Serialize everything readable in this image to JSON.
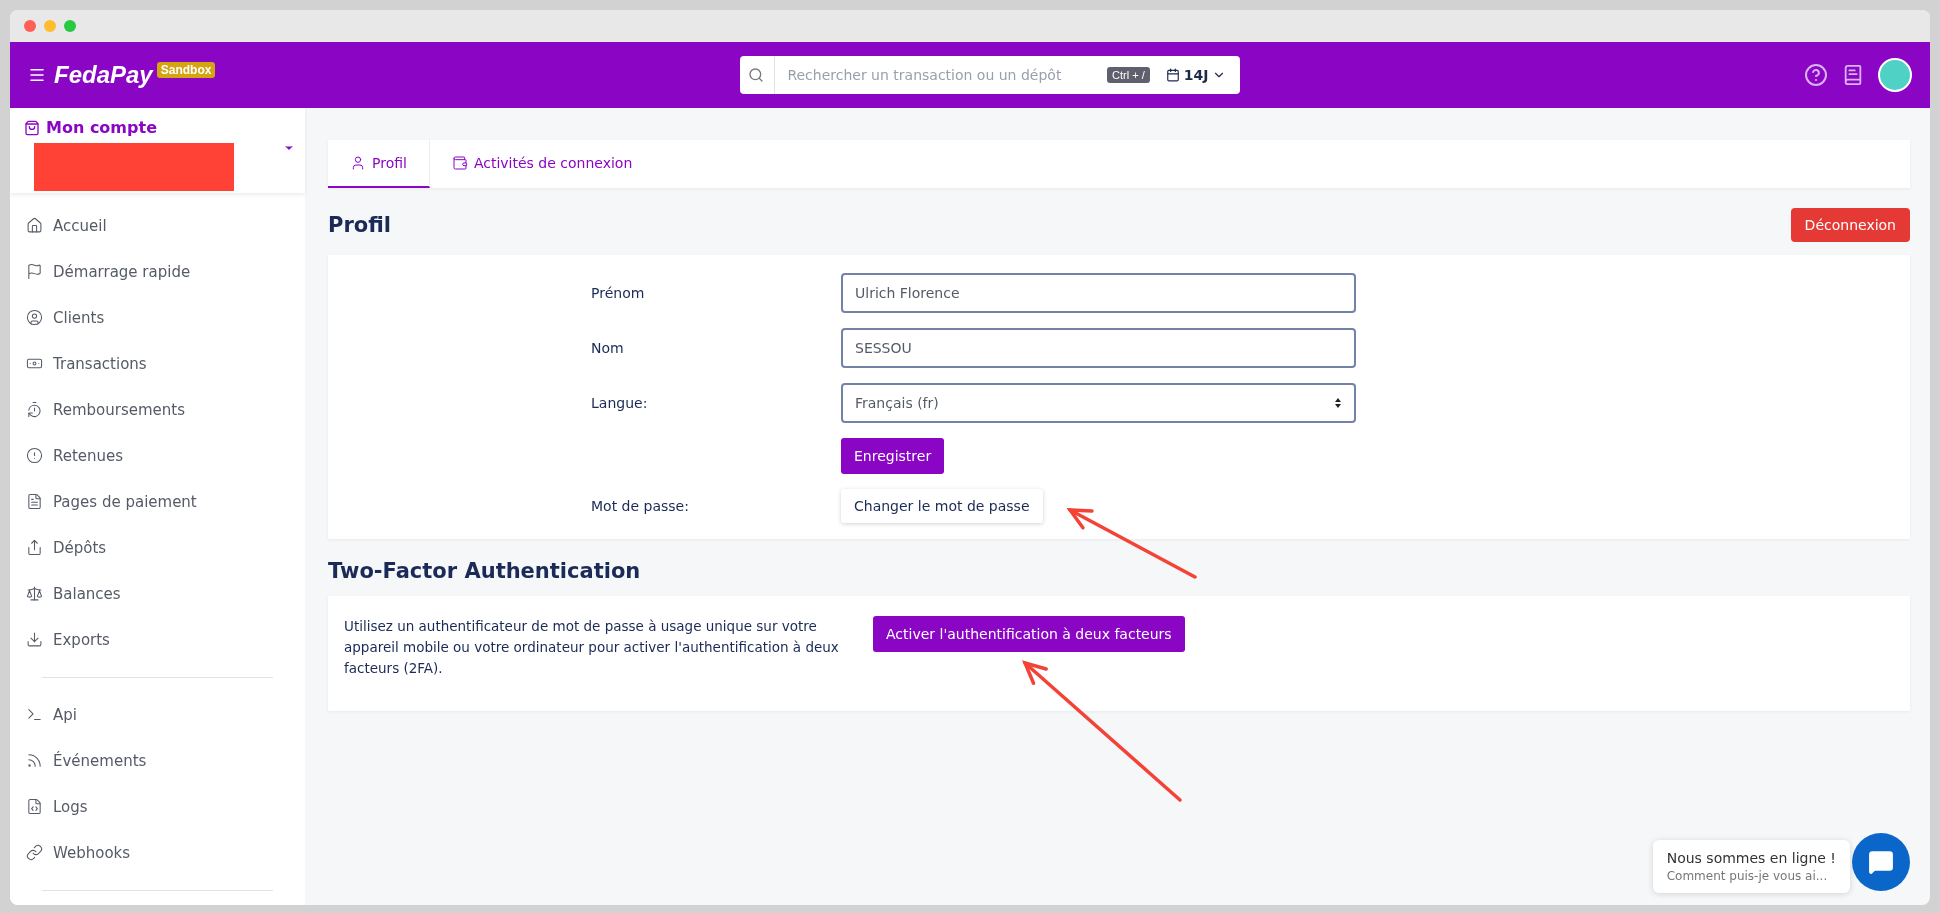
{
  "header": {
    "logo": "FedaPay",
    "badge": "Sandbox",
    "search": {
      "placeholder": "Rechercher un transaction ou un dépôt"
    },
    "shortcut": "Ctrl + /",
    "period": "14J"
  },
  "account": {
    "title": "Mon compte"
  },
  "sidebar": {
    "groups": [
      {
        "items": [
          "Accueil",
          "Démarrage rapide",
          "Clients",
          "Transactions",
          "Remboursements",
          "Retenues",
          "Pages de paiement",
          "Dépôts",
          "Balances",
          "Exports"
        ]
      },
      {
        "items": [
          "Api",
          "Événements",
          "Logs",
          "Webhooks"
        ]
      }
    ]
  },
  "tabs": [
    {
      "label": "Profil",
      "selected": true
    },
    {
      "label": "Activités de connexion",
      "selected": false
    }
  ],
  "profile": {
    "title": "Profil",
    "logout": "Déconnexion",
    "fields": [
      {
        "kind": "text",
        "label": "Prénom",
        "value": "Ulrich Florence"
      },
      {
        "kind": "text",
        "label": "Nom",
        "value": "SESSOU"
      },
      {
        "kind": "select",
        "label": "Langue:",
        "value": "Français (fr)"
      }
    ],
    "save": "Enregistrer",
    "password_label": "Mot de passe:",
    "password_button": "Changer le mot de passe"
  },
  "two_factor": {
    "title": "Two-Factor Authentication",
    "text": "Utilisez un authentificateur de mot de passe à usage unique sur votre appareil mobile ou votre ordinateur pour activer l'authentification à deux facteurs (2FA).",
    "button": "Activer l'authentification à deux facteurs"
  },
  "chat": {
    "title": "Nous sommes en ligne !",
    "subtitle": "Comment puis-je vous ai..."
  }
}
